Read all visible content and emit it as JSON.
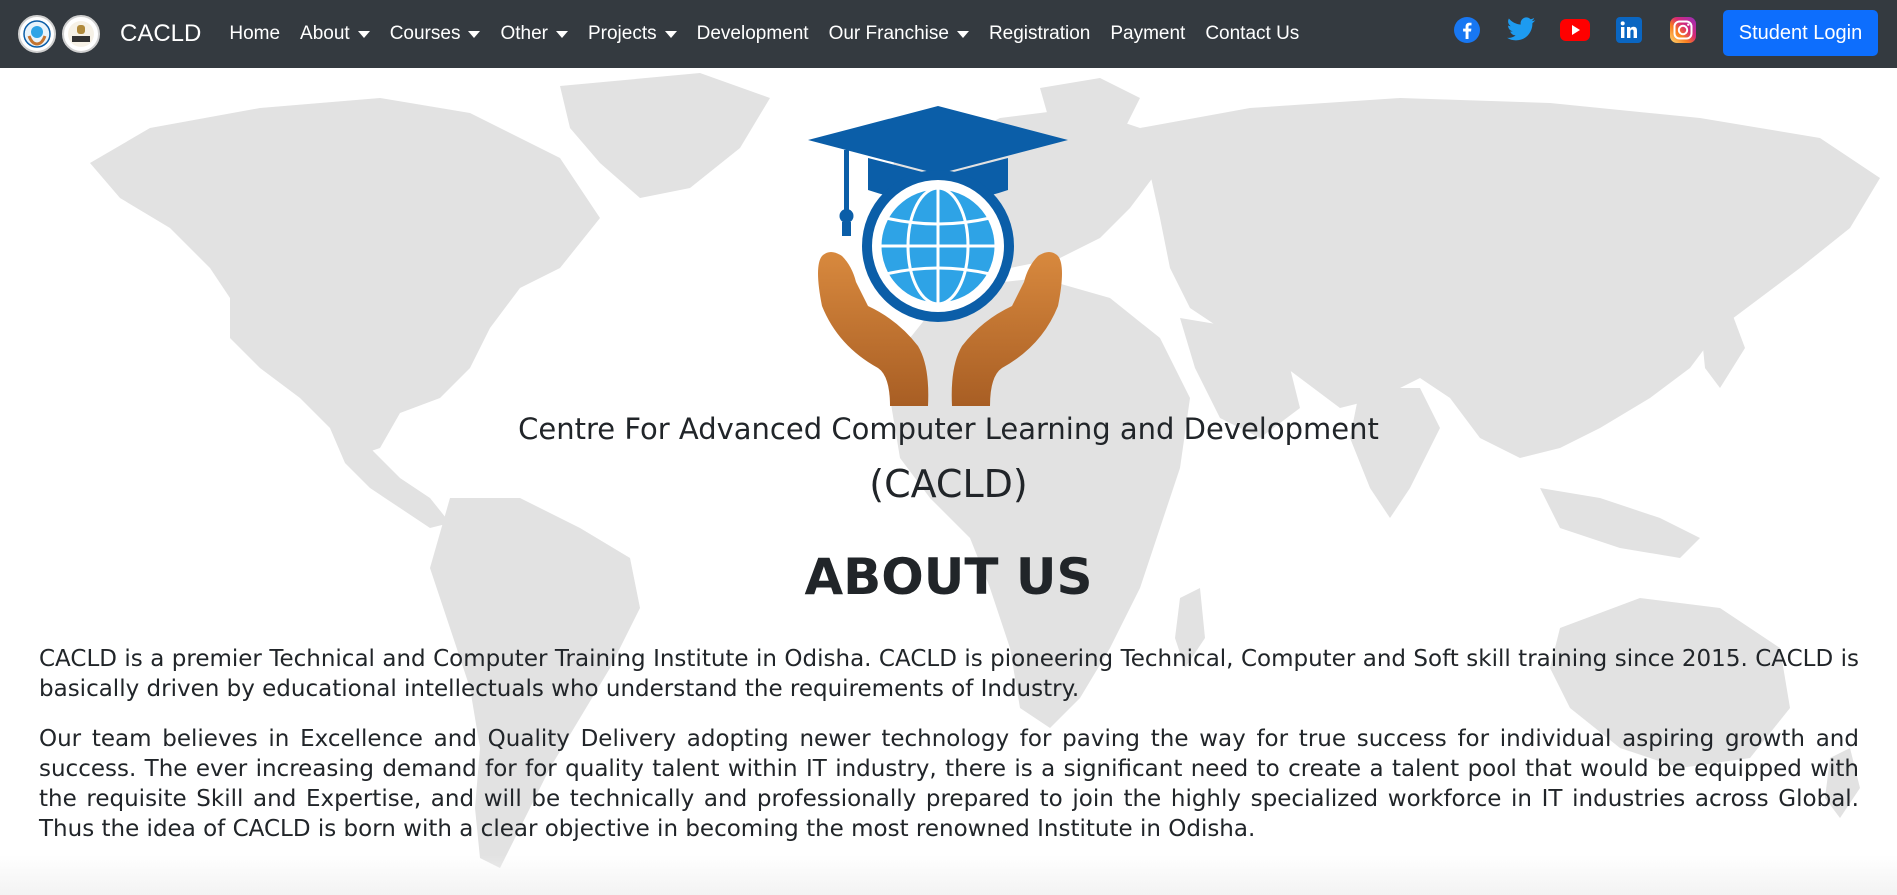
{
  "navbar": {
    "brand": "CACLD",
    "items": [
      {
        "label": "Home",
        "dropdown": false
      },
      {
        "label": "About",
        "dropdown": true
      },
      {
        "label": "Courses",
        "dropdown": true
      },
      {
        "label": "Other",
        "dropdown": true
      },
      {
        "label": "Projects",
        "dropdown": true
      },
      {
        "label": "Development",
        "dropdown": false
      },
      {
        "label": "Our Franchise",
        "dropdown": true
      },
      {
        "label": "Registration",
        "dropdown": false
      },
      {
        "label": "Payment",
        "dropdown": false
      },
      {
        "label": "Contact Us",
        "dropdown": false
      }
    ],
    "social_icons": [
      "facebook-icon",
      "twitter-icon",
      "youtube-icon",
      "linkedin-icon",
      "instagram-icon"
    ],
    "login_label": "Student Login"
  },
  "hero": {
    "title": "Centre For Advanced Computer Learning and Development",
    "abbr": "(CACLD)",
    "about_heading": "ABOUT US",
    "paragraphs": [
      "CACLD is a premier Technical and Computer Training Institute in Odisha. CACLD is pioneering Technical, Computer and Soft skill training since 2015. CACLD is basically driven by educational intellectuals who understand the requirements of Industry.",
      "Our team believes in Excellence and Quality Delivery adopting newer technology for paving the way for true success for individual aspiring growth and success. The ever increasing demand for for quality talent within IT industry, there is a significant need to create a talent pool that would be equipped with the requisite Skill and Expertise, and will be technically and professionally prepared to join the highly specialized workforce in IT industries across Global. Thus the idea of CACLD is born with a clear objective in becoming the most renowned Institute in Odisha."
    ]
  },
  "colors": {
    "navbar_bg": "#343a40",
    "login_button": "#0d6efd",
    "logo_cap": "#0b5ea8",
    "logo_globe": "#2ea3e6",
    "logo_hands": "#c47430",
    "map": "#e2e2e2"
  }
}
